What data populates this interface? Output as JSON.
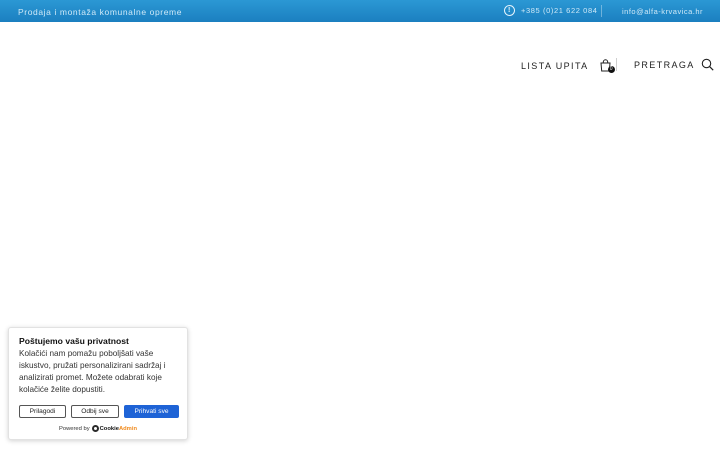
{
  "topbar": {
    "tagline": "Prodaja i montaža komunalne opreme",
    "phone": "+385 (0)21 622 084",
    "email": "info@alfa-krvavica.hr",
    "phone_icon": "exclamation-circle-icon"
  },
  "nav": {
    "inquiry_list": "LISTA UPITA",
    "cart_count": "0",
    "search": "PRETRAGA"
  },
  "cookie": {
    "title": "Poštujemo vašu privatnost",
    "body": "Kolačići nam pomažu poboljšati vaše iskustvo, pružati personalizirani sadržaj i analizirati promet. Možete odabrati koje kolačiće želite dopustiti.",
    "customize_label": "Prilagodi",
    "reject_label": "Odbij sve",
    "accept_label": "Prihvati sve",
    "powered_by": "Powered by",
    "brand_part1": "Cookie",
    "brand_part2": "Admin"
  },
  "colors": {
    "topbar": "#1b7fc0",
    "accent_button": "#1e63d6",
    "brand_orange": "#f08a1c"
  }
}
